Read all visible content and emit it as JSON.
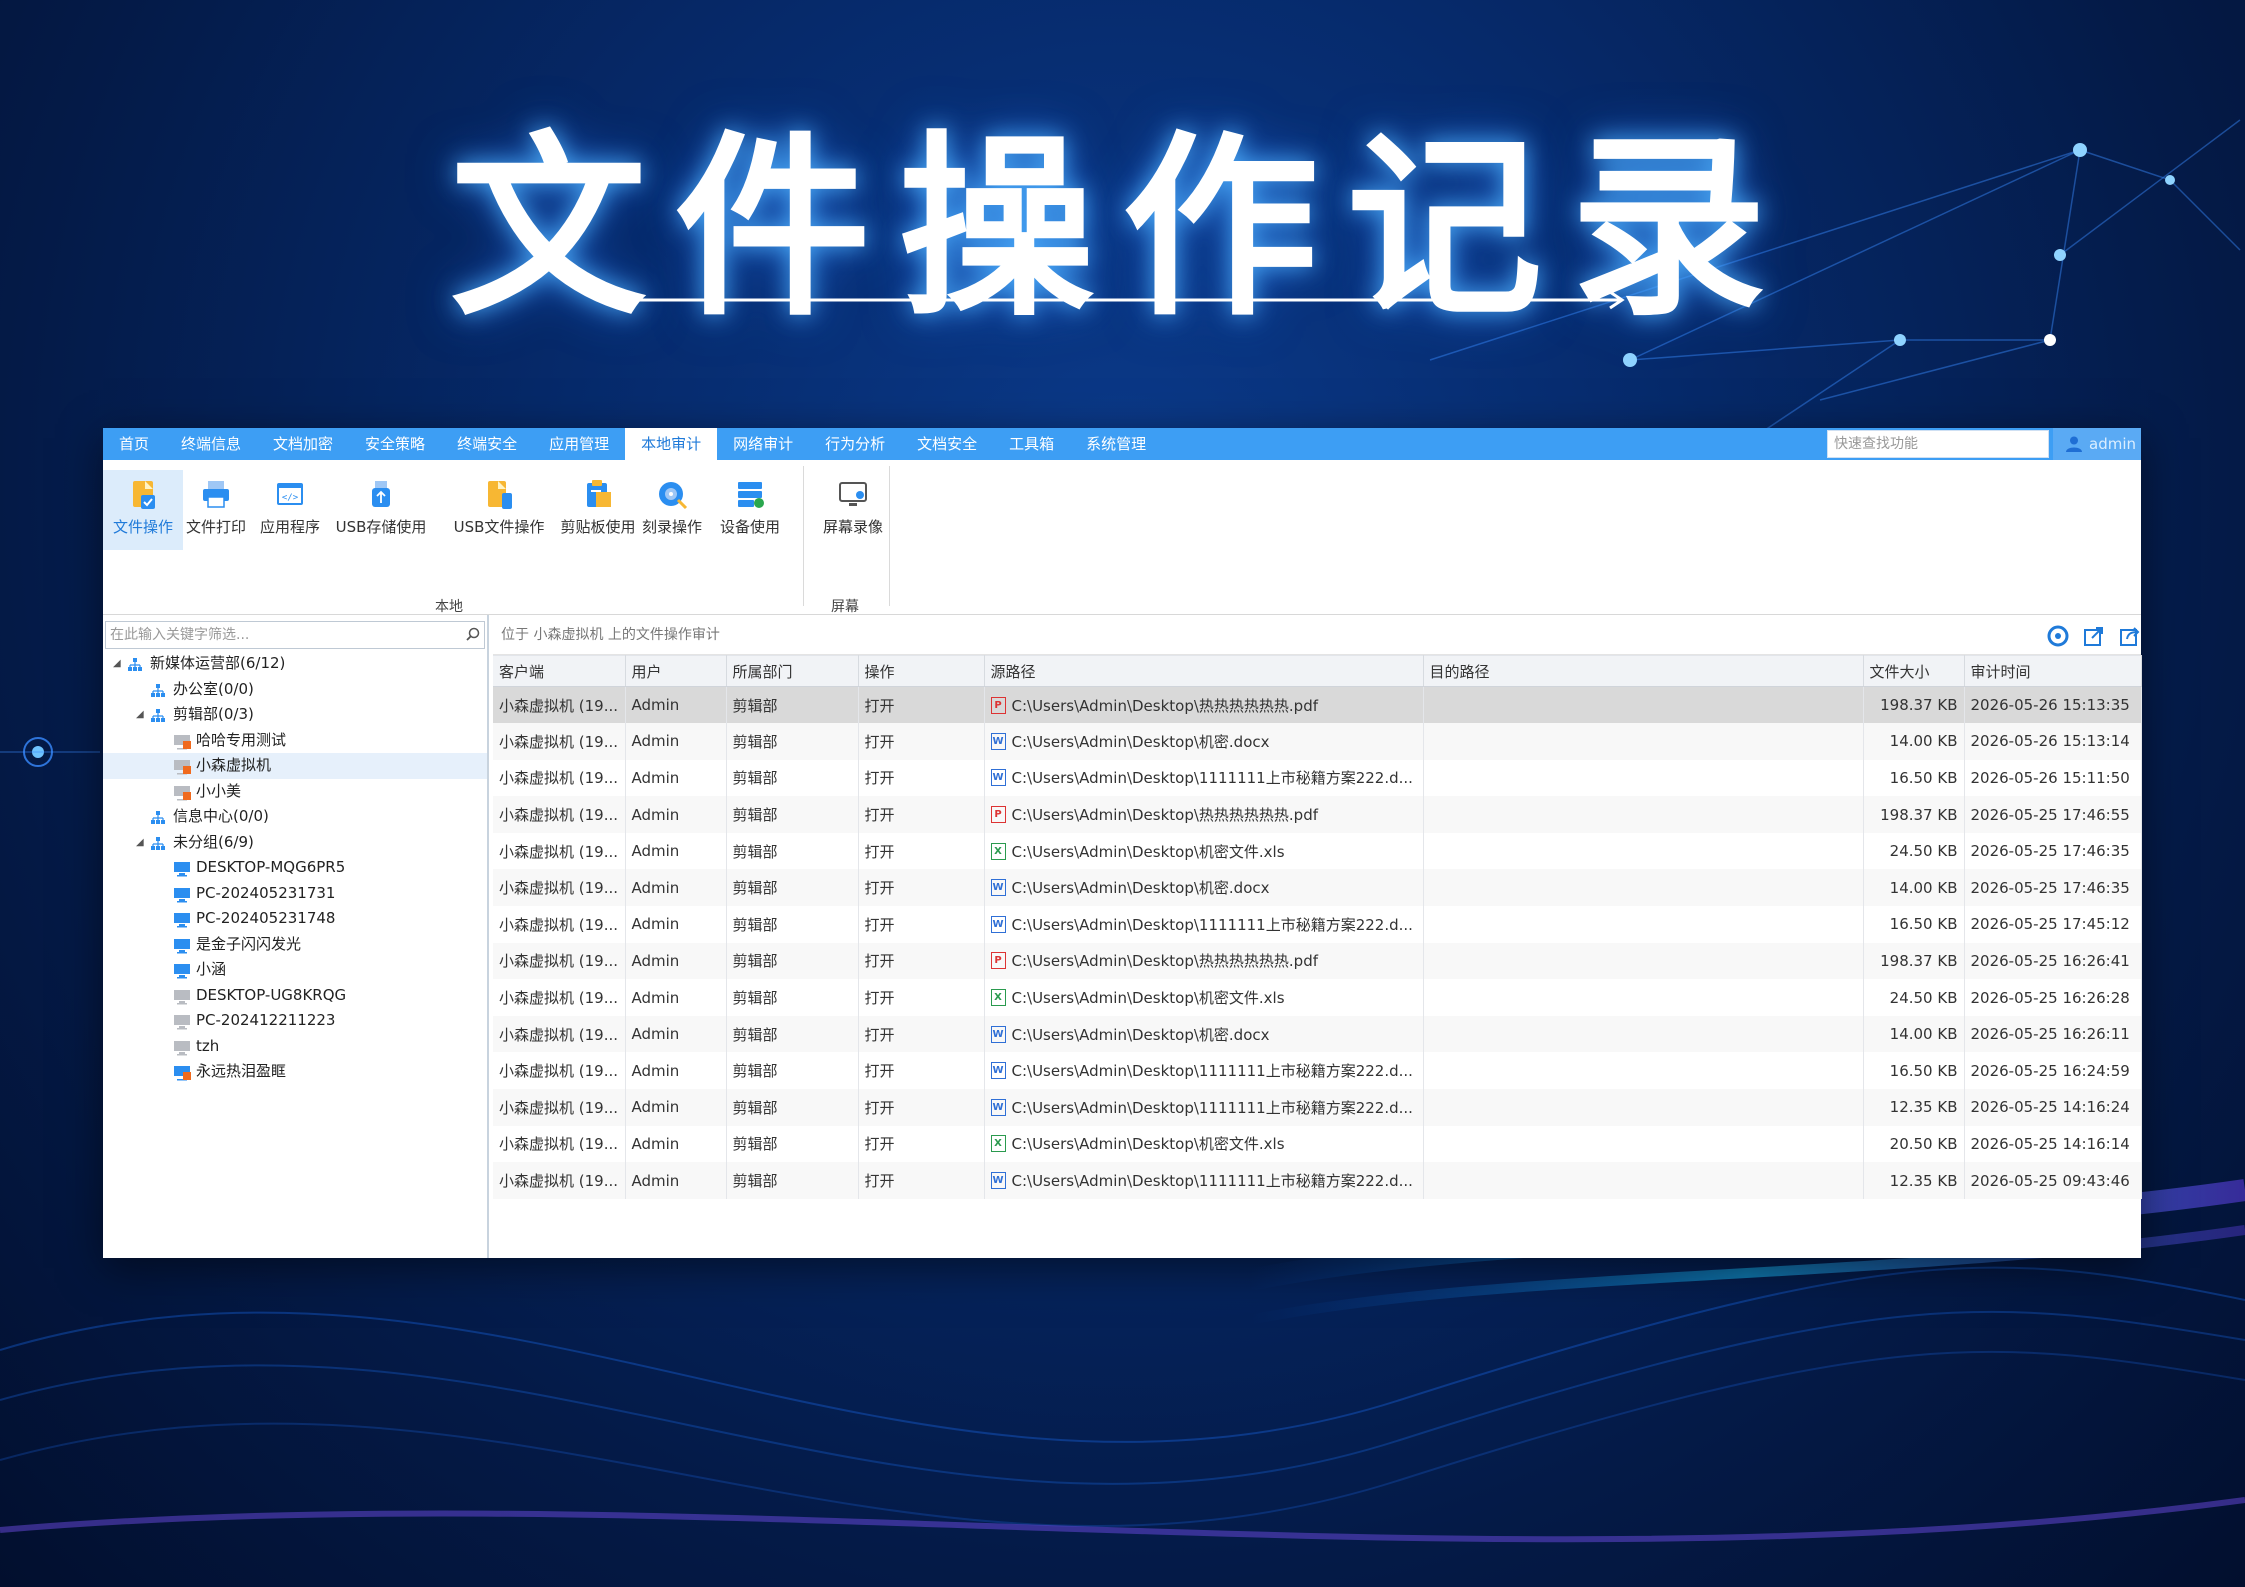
{
  "hero": {
    "title": "文件操作记录"
  },
  "menubar": {
    "items": [
      "首页",
      "终端信息",
      "文档加密",
      "安全策略",
      "终端安全",
      "应用管理",
      "本地审计",
      "网络审计",
      "行为分析",
      "文档安全",
      "工具箱",
      "系统管理"
    ],
    "active_index": 6,
    "quick_search_placeholder": "快速查找功能",
    "user": "admin"
  },
  "ribbon": {
    "buttons": [
      {
        "label": "文件操作",
        "icon": "file-operation-icon"
      },
      {
        "label": "文件打印",
        "icon": "printer-icon"
      },
      {
        "label": "应用程序",
        "icon": "application-icon"
      },
      {
        "label": "USB存储使用",
        "icon": "usb-storage-icon"
      },
      {
        "label": "USB文件操作",
        "icon": "usb-file-icon"
      },
      {
        "label": "剪贴板使用",
        "icon": "clipboard-icon"
      },
      {
        "label": "刻录操作",
        "icon": "disc-burn-icon"
      },
      {
        "label": "设备使用",
        "icon": "device-icon"
      },
      {
        "label": "屏幕录像",
        "icon": "screen-record-icon"
      }
    ],
    "groups": {
      "local": "本地",
      "screen": "屏幕"
    }
  },
  "tree": {
    "filter_placeholder": "在此输入关键字筛选...",
    "nodes": [
      {
        "label": "新媒体运营部(6/12)",
        "level": 0,
        "type": "group",
        "toggle": "◢"
      },
      {
        "label": "办公室(0/0)",
        "level": 1,
        "type": "group",
        "toggle": ""
      },
      {
        "label": "剪辑部(0/3)",
        "level": 1,
        "type": "group",
        "toggle": "◢"
      },
      {
        "label": "哈哈专用测试",
        "level": 2,
        "type": "offline",
        "toggle": ""
      },
      {
        "label": "小森虚拟机",
        "level": 2,
        "type": "offline",
        "toggle": "",
        "selected": true
      },
      {
        "label": "小小美",
        "level": 2,
        "type": "offline",
        "toggle": ""
      },
      {
        "label": "信息中心(0/0)",
        "level": 1,
        "type": "group",
        "toggle": ""
      },
      {
        "label": "未分组(6/9)",
        "level": 1,
        "type": "group",
        "toggle": "◢"
      },
      {
        "label": "DESKTOP-MQG6PR5",
        "level": 2,
        "type": "online",
        "toggle": ""
      },
      {
        "label": "PC-202405231731",
        "level": 2,
        "type": "online",
        "toggle": ""
      },
      {
        "label": "PC-202405231748",
        "level": 2,
        "type": "online",
        "toggle": ""
      },
      {
        "label": "是金子闪闪发光",
        "level": 2,
        "type": "online",
        "toggle": ""
      },
      {
        "label": "小涵",
        "level": 2,
        "type": "online",
        "toggle": ""
      },
      {
        "label": "DESKTOP-UG8KRQG",
        "level": 2,
        "type": "offline-grey",
        "toggle": ""
      },
      {
        "label": "PC-202412211223",
        "level": 2,
        "type": "offline-grey",
        "toggle": ""
      },
      {
        "label": "tzh",
        "level": 2,
        "type": "offline-grey",
        "toggle": ""
      },
      {
        "label": "永远热泪盈眶",
        "level": 2,
        "type": "alert",
        "toggle": ""
      }
    ]
  },
  "location_text": "位于 小森虚拟机 上的文件操作审计",
  "table": {
    "columns": [
      "客户端",
      "用户",
      "所属部门",
      "操作",
      "源路径",
      "目的路径",
      "文件大小",
      "审计时间"
    ],
    "rows": [
      [
        "小森虚拟机 (19...",
        "Admin",
        "剪辑部",
        "打开",
        "pdf",
        "C:\\Users\\Admin\\Desktop\\热热热热热热.pdf",
        "",
        "198.37 KB",
        "2026-05-26 15:13:35"
      ],
      [
        "小森虚拟机 (19...",
        "Admin",
        "剪辑部",
        "打开",
        "docx",
        "C:\\Users\\Admin\\Desktop\\机密.docx",
        "",
        "14.00 KB",
        "2026-05-26 15:13:14"
      ],
      [
        "小森虚拟机 (19...",
        "Admin",
        "剪辑部",
        "打开",
        "docx",
        "C:\\Users\\Admin\\Desktop\\1111111上市秘籍方案222.d...",
        "",
        "16.50 KB",
        "2026-05-26 15:11:50"
      ],
      [
        "小森虚拟机 (19...",
        "Admin",
        "剪辑部",
        "打开",
        "pdf",
        "C:\\Users\\Admin\\Desktop\\热热热热热热.pdf",
        "",
        "198.37 KB",
        "2026-05-25 17:46:55"
      ],
      [
        "小森虚拟机 (19...",
        "Admin",
        "剪辑部",
        "打开",
        "xls",
        "C:\\Users\\Admin\\Desktop\\机密文件.xls",
        "",
        "24.50 KB",
        "2026-05-25 17:46:35"
      ],
      [
        "小森虚拟机 (19...",
        "Admin",
        "剪辑部",
        "打开",
        "docx",
        "C:\\Users\\Admin\\Desktop\\机密.docx",
        "",
        "14.00 KB",
        "2026-05-25 17:46:35"
      ],
      [
        "小森虚拟机 (19...",
        "Admin",
        "剪辑部",
        "打开",
        "docx",
        "C:\\Users\\Admin\\Desktop\\1111111上市秘籍方案222.d...",
        "",
        "16.50 KB",
        "2026-05-25 17:45:12"
      ],
      [
        "小森虚拟机 (19...",
        "Admin",
        "剪辑部",
        "打开",
        "pdf",
        "C:\\Users\\Admin\\Desktop\\热热热热热热.pdf",
        "",
        "198.37 KB",
        "2026-05-25 16:26:41"
      ],
      [
        "小森虚拟机 (19...",
        "Admin",
        "剪辑部",
        "打开",
        "xls",
        "C:\\Users\\Admin\\Desktop\\机密文件.xls",
        "",
        "24.50 KB",
        "2026-05-25 16:26:28"
      ],
      [
        "小森虚拟机 (19...",
        "Admin",
        "剪辑部",
        "打开",
        "docx",
        "C:\\Users\\Admin\\Desktop\\机密.docx",
        "",
        "14.00 KB",
        "2026-05-25 16:26:11"
      ],
      [
        "小森虚拟机 (19...",
        "Admin",
        "剪辑部",
        "打开",
        "docx",
        "C:\\Users\\Admin\\Desktop\\1111111上市秘籍方案222.d...",
        "",
        "16.50 KB",
        "2026-05-25 16:24:59"
      ],
      [
        "小森虚拟机 (19...",
        "Admin",
        "剪辑部",
        "打开",
        "docx",
        "C:\\Users\\Admin\\Desktop\\1111111上市秘籍方案222.d...",
        "",
        "12.35 KB",
        "2026-05-25 14:16:24"
      ],
      [
        "小森虚拟机 (19...",
        "Admin",
        "剪辑部",
        "打开",
        "xls",
        "C:\\Users\\Admin\\Desktop\\机密文件.xls",
        "",
        "20.50 KB",
        "2026-05-25 14:16:14"
      ],
      [
        "小森虚拟机 (19...",
        "Admin",
        "剪辑部",
        "打开",
        "docx",
        "C:\\Users\\Admin\\Desktop\\1111111上市秘籍方案222.d...",
        "",
        "12.35 KB",
        "2026-05-25 09:43:46"
      ]
    ],
    "selected_row": 0
  },
  "colors": {
    "accent": "#3d9ef4",
    "active_tab_text": "#1f7ad9",
    "pdf": "#dd3333",
    "docx": "#2f6fd6",
    "xls": "#2a9a4e"
  }
}
